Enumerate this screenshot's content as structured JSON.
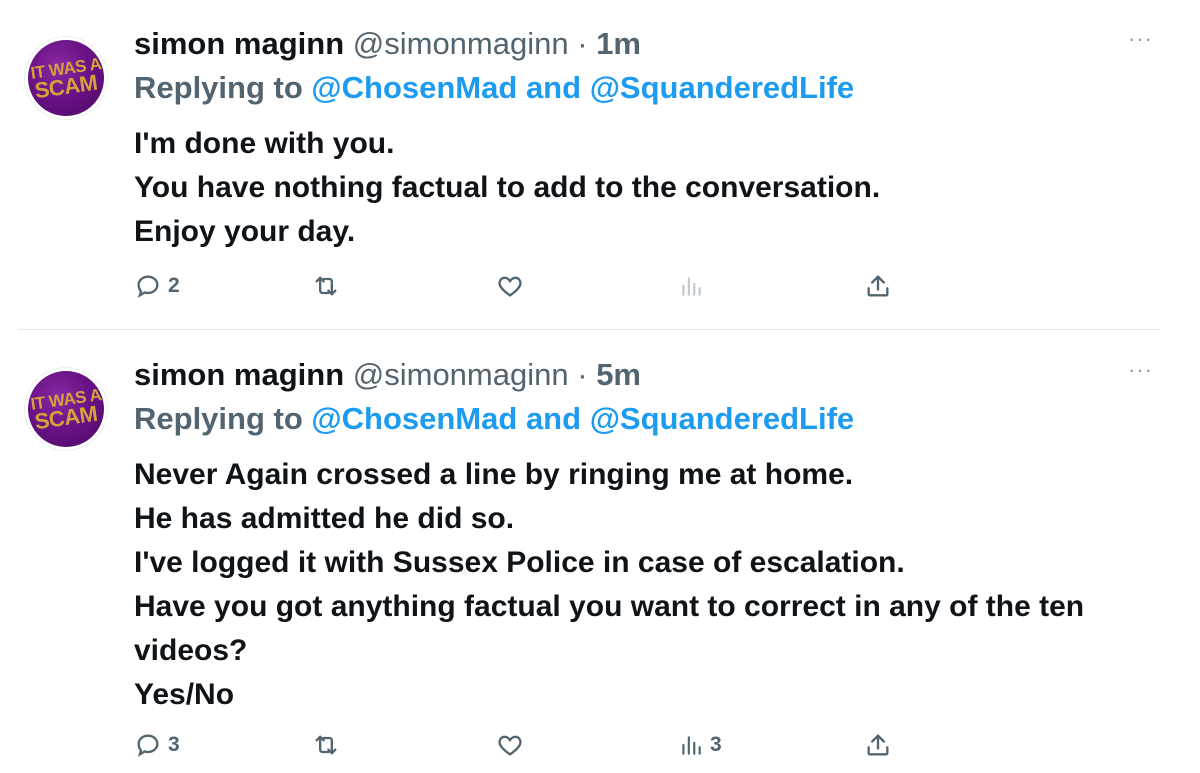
{
  "tweets": [
    {
      "name": "simon maginn",
      "handle": "@simonmaginn",
      "separator": "·",
      "time": "1m",
      "avatar_text": [
        "IT WAS A",
        "SCAM"
      ],
      "replying_label": "Replying to",
      "reply_to": [
        "@ChosenMad",
        "@SquanderedLife"
      ],
      "reply_conjunction": "and",
      "more_label": "···",
      "body_lines": [
        "I'm done with you.",
        "You have nothing factual to add to the conversation.",
        "Enjoy your day."
      ],
      "actions": {
        "reply_count": "2",
        "retweet_count": "",
        "like_count": "",
        "views_count": ""
      }
    },
    {
      "name": "simon maginn",
      "handle": "@simonmaginn",
      "separator": "·",
      "time": "5m",
      "avatar_text": [
        "IT WAS A",
        "SCAM"
      ],
      "replying_label": "Replying to",
      "reply_to": [
        "@ChosenMad",
        "@SquanderedLife"
      ],
      "reply_conjunction": "and",
      "more_label": "···",
      "body_lines": [
        "Never Again crossed a line by ringing me at home.",
        "He has admitted he did so.",
        "I've logged it with Sussex Police in case of escalation.",
        "Have you got anything factual you want to correct in any of the ten",
        "videos?",
        "Yes/No"
      ],
      "actions": {
        "reply_count": "3",
        "retweet_count": "",
        "like_count": "",
        "views_count": "3"
      }
    }
  ],
  "icons": {
    "reply": "reply-icon",
    "retweet": "retweet-icon",
    "like": "heart-icon",
    "views": "views-icon",
    "share": "share-icon",
    "more": "more-icon"
  },
  "colors": {
    "link": "#1d9bf0",
    "secondary_text": "#536471",
    "avatar_bg": "#6a1286",
    "avatar_text": "#d4a13a"
  }
}
